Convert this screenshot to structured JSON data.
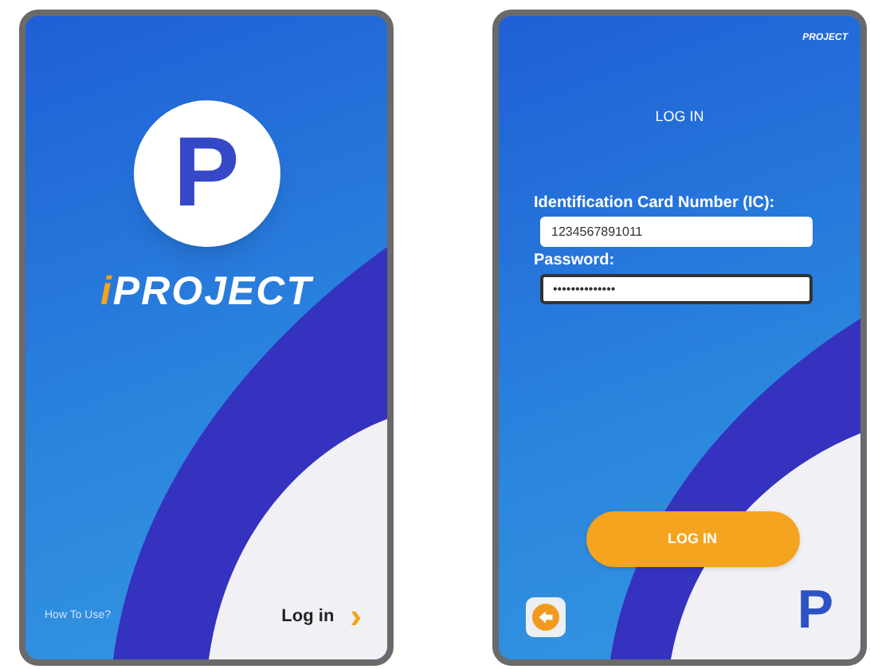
{
  "splash_screen": {
    "logo_letter": "P",
    "brand": {
      "accent": "i",
      "rest": "PROJECT"
    },
    "help_link": "How To Use?",
    "login_link": "Log in",
    "login_chevron": "›"
  },
  "login_screen": {
    "brand": "PROJECT",
    "title": "LOG IN",
    "fields": [
      {
        "label": "Identification Card Number (IC):",
        "value": "1234567891011",
        "focused": false
      },
      {
        "label": "Password:",
        "value": "••••••••••••••",
        "focused": true
      }
    ],
    "submit_button": "LOG IN",
    "logo_letter": "P"
  }
}
